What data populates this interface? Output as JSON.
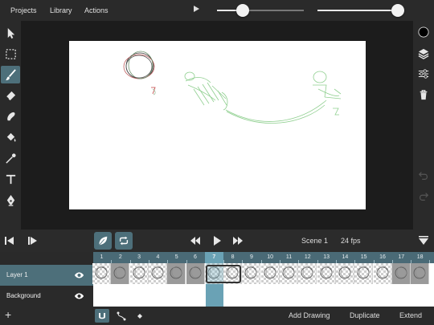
{
  "menu": {
    "projects": "Projects",
    "library": "Library",
    "actions": "Actions"
  },
  "sliders": [
    {
      "name": "size",
      "value": 0.3
    },
    {
      "name": "opacity",
      "value": 1.0
    }
  ],
  "left_tools": [
    "select-arrow-icon",
    "lasso-select-icon",
    "brush-icon",
    "eraser-icon",
    "smudge-icon",
    "fill-bucket-icon",
    "eyedropper-icon",
    "text-icon",
    "pen-icon"
  ],
  "active_tool": "brush-icon",
  "right_tools": [
    "color-swatch",
    "layers-icon",
    "adjustments-icon",
    "trash-icon",
    "undo-icon",
    "redo-icon"
  ],
  "current_color": "#000000",
  "playback": {
    "scene": "Scene 1",
    "fps": "24 fps"
  },
  "timeline": {
    "frames": [
      "1",
      "2",
      "3",
      "4",
      "5",
      "6",
      "7",
      "8",
      "9",
      "10",
      "11",
      "12",
      "13",
      "14",
      "15",
      "16",
      "17",
      "18"
    ],
    "current_frame": "7"
  },
  "layers": [
    {
      "name": "Layer 1",
      "visible": true,
      "selected": true
    },
    {
      "name": "Background",
      "visible": true,
      "selected": false
    }
  ],
  "bottom": {
    "add_drawing": "Add Drawing",
    "duplicate": "Duplicate",
    "extend": "Extend",
    "add": "+"
  },
  "colors": {
    "accent": "#4d6f7a",
    "highlight": "#6aa2b5",
    "panel": "#2a2a2a"
  }
}
